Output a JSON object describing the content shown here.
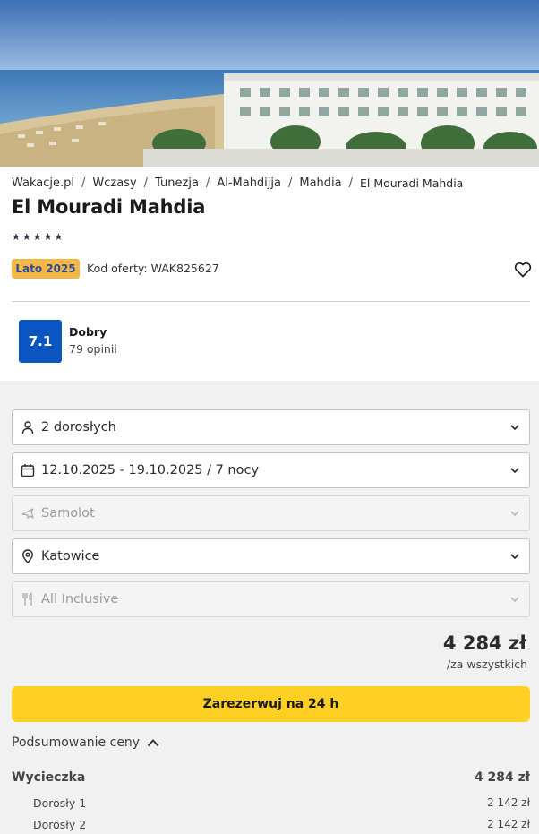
{
  "breadcrumb": [
    "Wakacje.pl",
    "Wczasy",
    "Tunezja",
    "Al-Mahdijja",
    "Mahdia",
    "El Mouradi Mahdia"
  ],
  "breadcrumb_separator": "/",
  "hotel": {
    "name": "El Mouradi Mahdia",
    "stars": 5,
    "star_glyph": "★",
    "season_badge": "Lato 2025",
    "offer_code": "Kod oferty: WAK825627"
  },
  "rating": {
    "score": "7.1",
    "label": "Dobry",
    "count": "79 opinii",
    "color": "#0a55c1"
  },
  "form": {
    "travelers": "2 dorosłych",
    "dates": "12.10.2025 - 19.10.2025 / 7 nocy",
    "transport": "Samolot",
    "departure": "Katowice",
    "board": "All Inclusive"
  },
  "price": {
    "total": "4 284 zł",
    "note": "/za wszystkich"
  },
  "book_button": "Zarezerwuj na 24 h",
  "book_button_color": "#fdd023",
  "summary": {
    "toggle": "Podsumowanie ceny",
    "trip_label": "Wycieczka",
    "trip_value": "4 284 zł",
    "lines": [
      {
        "label": "Dorosły 1",
        "value": "2 142 zł"
      },
      {
        "label": "Dorosły 2",
        "value": "2 142 zł"
      }
    ]
  }
}
